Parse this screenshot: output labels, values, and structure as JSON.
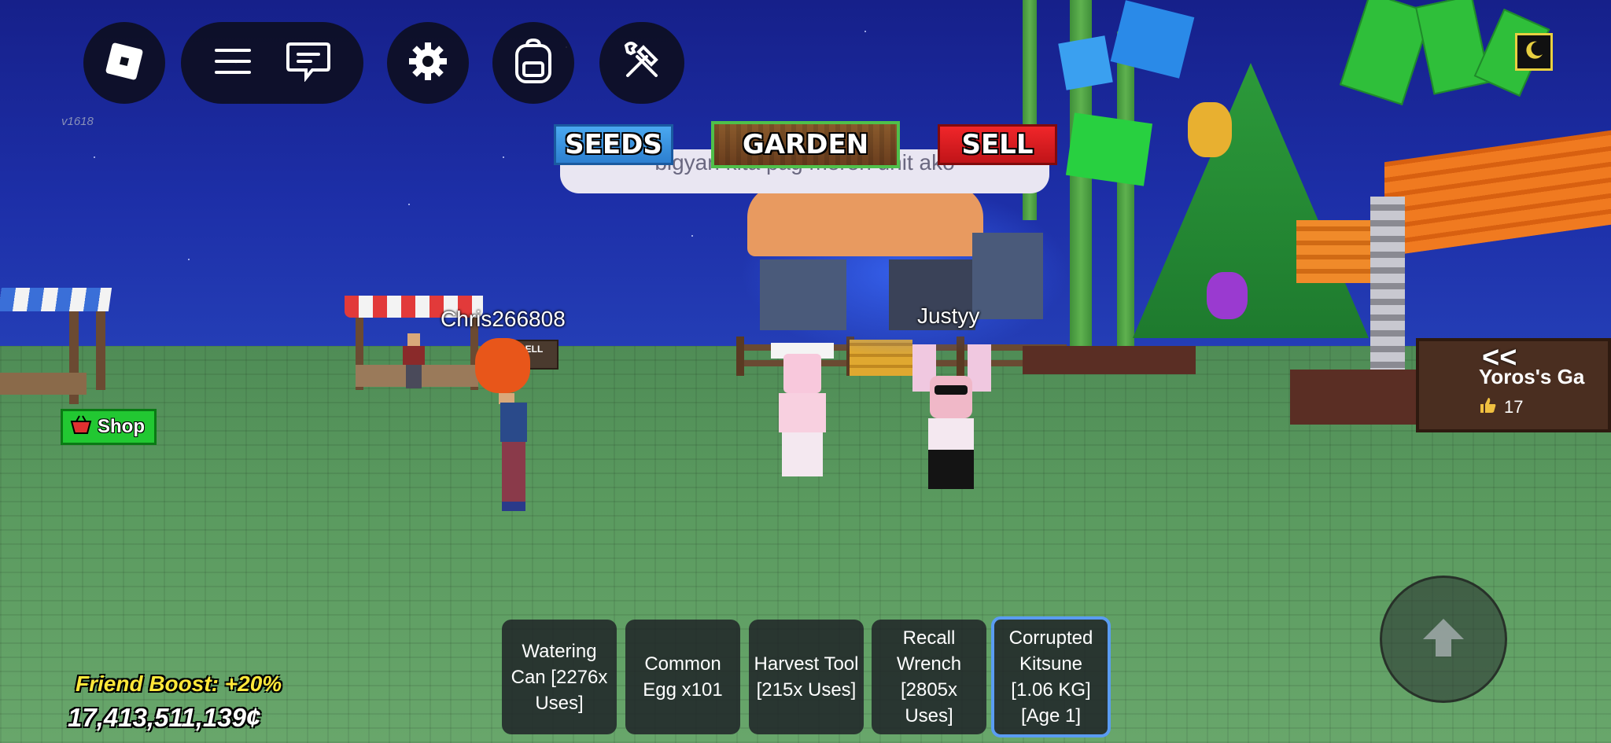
{
  "top_bar": {
    "version": "v1618",
    "icons": [
      "roblox-logo-icon",
      "menu-icon",
      "chat-icon",
      "settings-icon",
      "backpack-icon",
      "build-tools-icon"
    ]
  },
  "nav": {
    "seeds_label": "SEEDS",
    "garden_label": "GARDEN",
    "sell_label": "SELL"
  },
  "chat_bubble": {
    "text": "bigyan kita pag mereh unit ako"
  },
  "players": {
    "player1_name": "Chris266808",
    "player2_name": "Justyy"
  },
  "stall_sign": "SELL",
  "shop": {
    "label": "Shop"
  },
  "sign": {
    "arrows": "<<",
    "owner_text": "Yoros's Ga",
    "likes": "17"
  },
  "stats": {
    "friend_boost": "Friend Boost: +20%",
    "money": "17,413,511,139¢"
  },
  "hotbar": [
    {
      "label": "Watering Can [2276x Uses]",
      "selected": false
    },
    {
      "label": "Common Egg x101",
      "selected": false
    },
    {
      "label": "Harvest Tool [215x Uses]",
      "selected": false
    },
    {
      "label": "Recall Wrench [2805x Uses]",
      "selected": false
    },
    {
      "label": "Corrupted Kitsune [1.06 KG] [Age 1]",
      "selected": true
    }
  ],
  "colors": {
    "sky": "#1d2fa8",
    "grass": "#5a9a5f",
    "seeds": "#2c7fd0",
    "garden": "#7a4a24",
    "sell": "#d81c20",
    "shop": "#22c832",
    "boost": "#ffe83a",
    "hotbar_selected": "#5a9cf2"
  }
}
